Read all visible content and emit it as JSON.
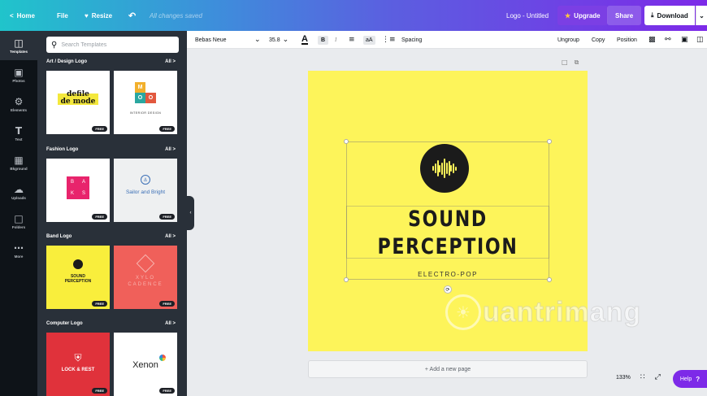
{
  "topbar": {
    "home": "Home",
    "file": "File",
    "resize": "Resize",
    "saved": "All changes saved",
    "doc_title": "Logo - Untitled",
    "upgrade": "Upgrade",
    "share": "Share",
    "download": "Download"
  },
  "rail": [
    {
      "label": "Templates",
      "icon": "templates-icon"
    },
    {
      "label": "Photos",
      "icon": "photos-icon"
    },
    {
      "label": "Elements",
      "icon": "elements-icon"
    },
    {
      "label": "Text",
      "icon": "text-icon"
    },
    {
      "label": "Bkground",
      "icon": "background-icon"
    },
    {
      "label": "Uploads",
      "icon": "uploads-icon"
    },
    {
      "label": "Folders",
      "icon": "folders-icon"
    },
    {
      "label": "More",
      "icon": "more-icon"
    }
  ],
  "panel": {
    "search_placeholder": "Search Templates",
    "all_label": "All",
    "sections": [
      {
        "title": "Art / Design Logo"
      },
      {
        "title": "Fashion Logo"
      },
      {
        "title": "Band Logo"
      },
      {
        "title": "Computer Logo"
      }
    ],
    "free_badge": "FREE",
    "templates": {
      "defile_line1": "defile",
      "defile_line2": "de mode",
      "moon_letters": [
        "M",
        "O",
        "O",
        "N"
      ],
      "moon_caption": "INTERIOR DESIGN",
      "baks_letters": [
        "B",
        "A",
        "K",
        "S"
      ],
      "sailor": "Sailor and Bright",
      "band1_line1": "SOUND",
      "band1_line2": "PERCEPTION",
      "band2_line1": "XYLO",
      "band2_line2": "CADENCE",
      "lock": "LOCK & REST",
      "xenon": "Xenon"
    }
  },
  "toolbar": {
    "font": "Bebas Neue",
    "size": "35.8",
    "bold": "B",
    "italic": "I",
    "case": "aA",
    "spacing": "Spacing",
    "ungroup": "Ungroup",
    "copy": "Copy",
    "position": "Position"
  },
  "canvas": {
    "title_line1": "SOUND",
    "title_line2": "PERCEPTION",
    "subtitle": "ELECTRO-POP",
    "page_color": "#fdf45a"
  },
  "add_page": "+ Add a new page",
  "zoom": "133%",
  "help": "Help",
  "help_mark": "?",
  "watermark": "uantrimang"
}
